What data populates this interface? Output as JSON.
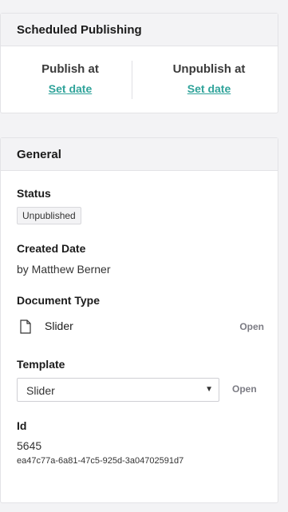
{
  "scheduled": {
    "title": "Scheduled Publishing",
    "publish_label": "Publish at",
    "publish_link": "Set date",
    "unpublish_label": "Unpublish at",
    "unpublish_link": "Set date"
  },
  "general": {
    "title": "General",
    "status_label": "Status",
    "status_value": "Unpublished",
    "created_label": "Created Date",
    "created_by": "by Matthew Berner",
    "doctype_label": "Document Type",
    "doctype_value": "Slider",
    "doctype_open": "Open",
    "template_label": "Template",
    "template_value": "Slider",
    "template_open": "Open",
    "id_label": "Id",
    "id_value": "5645",
    "guid_value": "ea47c77a-6a81-47c5-925d-3a04702591d7"
  }
}
